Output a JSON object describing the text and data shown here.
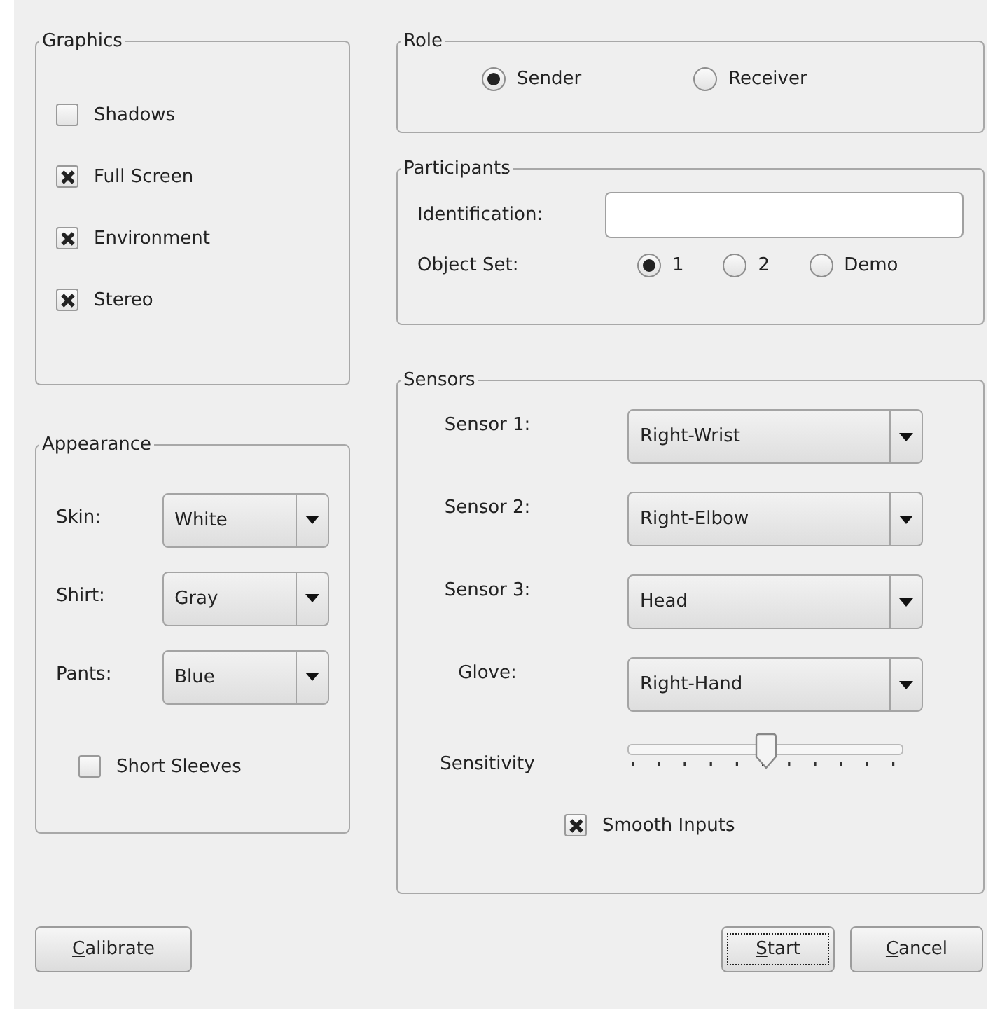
{
  "graphics": {
    "title": "Graphics",
    "options": [
      {
        "label": "Shadows",
        "checked": false
      },
      {
        "label": "Full Screen",
        "checked": true
      },
      {
        "label": "Environment",
        "checked": true
      },
      {
        "label": "Stereo",
        "checked": true
      }
    ]
  },
  "appearance": {
    "title": "Appearance",
    "fields": [
      {
        "label": "Skin:",
        "value": "White"
      },
      {
        "label": "Shirt:",
        "value": "Gray"
      },
      {
        "label": "Pants:",
        "value": "Blue"
      }
    ],
    "options": [
      {
        "label": "Short Sleeves",
        "checked": false
      }
    ]
  },
  "role": {
    "title": "Role",
    "options": [
      {
        "label": "Sender",
        "selected": true
      },
      {
        "label": "Receiver",
        "selected": false
      }
    ]
  },
  "participants": {
    "title": "Participants",
    "identification": {
      "label": "Identification:"
    },
    "object_set": {
      "label": "Object Set:",
      "options": [
        {
          "label": "1",
          "selected": true
        },
        {
          "label": "2",
          "selected": false
        },
        {
          "label": "Demo",
          "selected": false
        }
      ]
    }
  },
  "sensors": {
    "title": "Sensors",
    "rows": [
      {
        "kind": "combo",
        "label": "Sensor 1:",
        "value": "Right-Wrist"
      },
      {
        "kind": "combo",
        "label": "Sensor 2:",
        "value": "Right-Elbow"
      },
      {
        "kind": "combo",
        "label": "Sensor 3:",
        "value": "Head"
      },
      {
        "kind": "combo",
        "label": "Glove:",
        "value": "Right-Hand"
      },
      {
        "kind": "slider",
        "label": "Sensitivity",
        "level": 0.5
      },
      {
        "kind": "checkbox",
        "label": "Smooth Inputs",
        "checked": true
      }
    ]
  },
  "buttons_left": [
    {
      "mnemonic": "C",
      "rest": "alibrate",
      "focused": false
    }
  ],
  "buttons_right": [
    {
      "mnemonic": "S",
      "rest": "tart",
      "focused": true
    },
    {
      "mnemonic": "C",
      "rest": "ancel",
      "focused": false
    }
  ]
}
